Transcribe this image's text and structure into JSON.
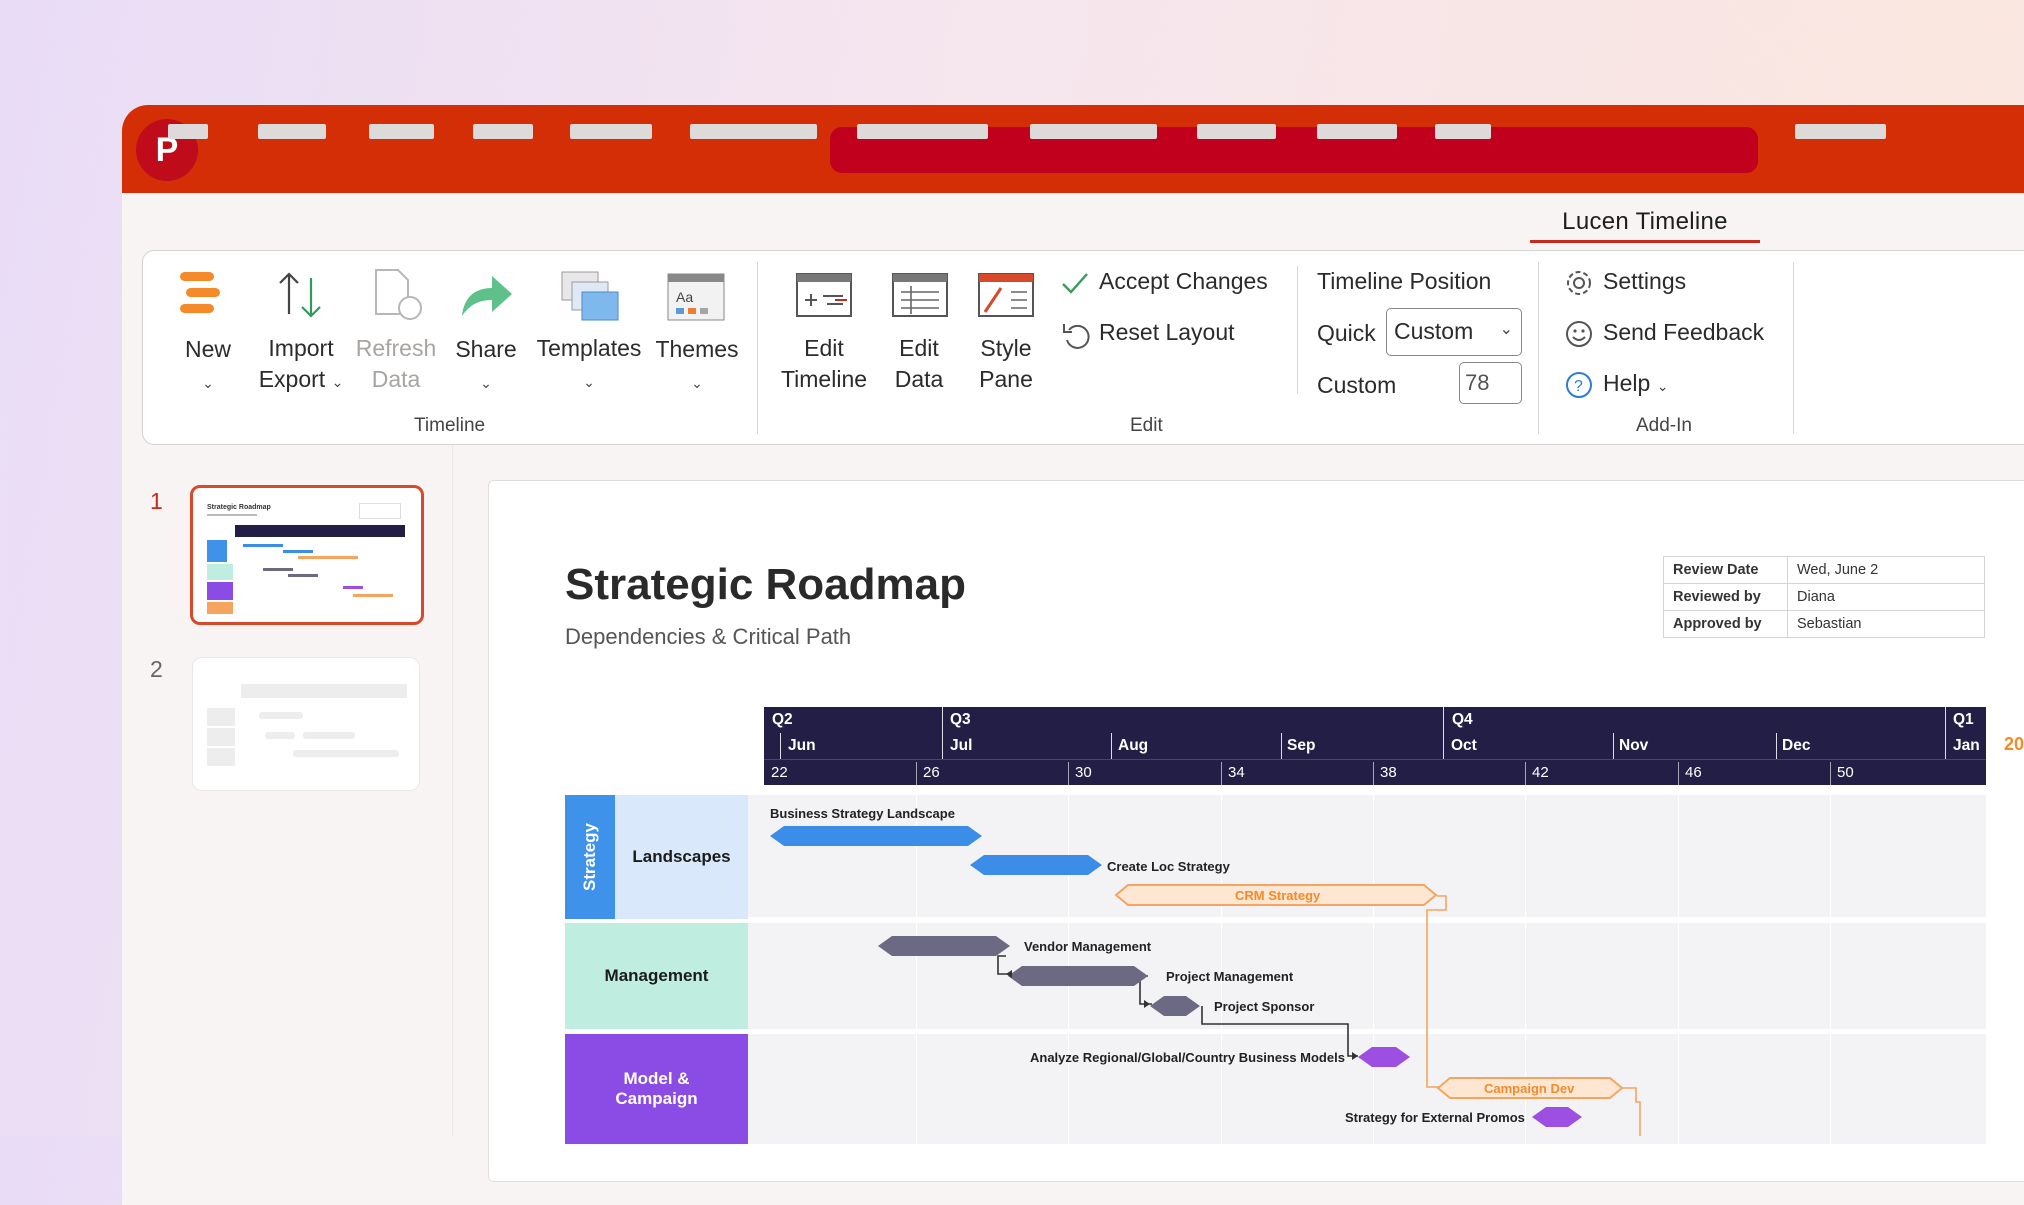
{
  "app": {
    "logo_letter": "P",
    "active_tab": "Lucen Timeline"
  },
  "ribbon": {
    "timeline_group": {
      "label": "Timeline",
      "new": "New",
      "import": "Import",
      "export": "Export",
      "refresh1": "Refresh",
      "refresh2": "Data",
      "share": "Share",
      "templates": "Templates",
      "themes": "Themes"
    },
    "edit_group": {
      "label": "Edit",
      "edit_timeline1": "Edit",
      "edit_timeline2": "Timeline",
      "edit_data1": "Edit",
      "edit_data2": "Data",
      "style_pane1": "Style",
      "style_pane2": "Pane",
      "accept_changes": "Accept Changes",
      "reset_layout": "Reset Layout",
      "timeline_position": "Timeline Position",
      "quick_label": "Quick",
      "quick_value": "Custom",
      "custom_label": "Custom",
      "custom_value": "78"
    },
    "addin_group": {
      "label": "Add-In",
      "settings": "Settings",
      "send_feedback": "Send Feedback",
      "help": "Help"
    },
    "colors": {
      "accent": "#d42e07",
      "active_tab_underline": "#c42b1c"
    }
  },
  "slides_pane": {
    "slides": [
      "1",
      "2"
    ],
    "thumb1_title": "Strategic Roadmap"
  },
  "slide": {
    "title": "Strategic Roadmap",
    "subtitle": "Dependencies & Critical Path",
    "review": [
      {
        "k": "Review Date",
        "v": "Wed, June 2"
      },
      {
        "k": "Reviewed by",
        "v": "Diana"
      },
      {
        "k": "Approved by",
        "v": "Sebastian"
      }
    ],
    "header": {
      "quarters": [
        "Q2",
        "Q3",
        "Q4",
        "Q1"
      ],
      "months": [
        "Jun",
        "Jul",
        "Aug",
        "Sep",
        "Oct",
        "Nov",
        "Dec",
        "Jan"
      ],
      "weeks": [
        "22",
        "26",
        "30",
        "34",
        "38",
        "42",
        "46",
        "50"
      ],
      "year_fragment": "20"
    },
    "swimlanes": {
      "strategy": "Strategy",
      "landscapes": "Landscapes",
      "management": "Management",
      "model": "Model & Campaign"
    },
    "tasks": {
      "t1": "Business Strategy Landscape",
      "t2": "Create Loc Strategy",
      "t3": "CRM Strategy",
      "t4": "Vendor Management",
      "t5": "Project Management",
      "t6": "Project Sponsor",
      "t7": "Analyze Regional/Global/Country Business Models",
      "t8": "Campaign Dev",
      "t9": "Strategy for External Promos"
    },
    "colors": {
      "header": "#221e45",
      "blue": "#3b8de8",
      "orange": "#f5a55f",
      "gray": "#6b6a82",
      "purple": "#9c4fe0",
      "strategy_lane": "#3e92ea",
      "landscapes_lane": "#d9e8fb",
      "management_lane": "#bfeee0",
      "model_lane": "#8a4ce4"
    }
  }
}
